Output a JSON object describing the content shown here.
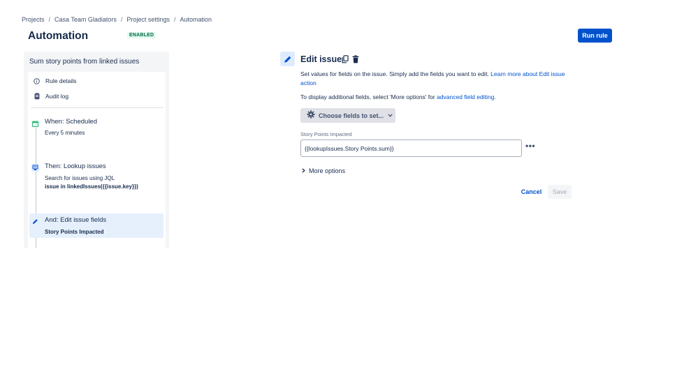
{
  "breadcrumb": {
    "items": [
      "Projects",
      "Casa Team Gladiators",
      "Project settings",
      "Automation"
    ],
    "separator": "/"
  },
  "page": {
    "title": "Automation",
    "status": "ENABLED",
    "run_rule_label": "Run rule"
  },
  "rule_panel": {
    "rule_name": "Sum story points from linked issues",
    "nav": [
      {
        "label": "Rule details",
        "icon": "info-icon"
      },
      {
        "label": "Audit log",
        "icon": "clipboard-icon"
      }
    ],
    "steps": [
      {
        "title": "When: Scheduled",
        "subtitle": "Every 5 minutes",
        "icon": "calendar-icon"
      },
      {
        "title": "Then: Lookup issues",
        "subtitle": "Search for issues using JQL",
        "detail": "issue in linkedIssues({{issue.key}})",
        "icon": "lookup-icon"
      },
      {
        "title": "And: Edit issue fields",
        "detail": "Story Points Impacted",
        "icon": "pencil-icon"
      }
    ]
  },
  "editor": {
    "title": "Edit issue",
    "description_line1": "Set values for fields on the issue. Simply add the fields you want to edit. ",
    "learn_more_link": "Learn more about Edit issue action",
    "description2": "To display additional fields, select 'More options' for ",
    "advanced_link": "advanced field editing",
    "description2_end": ".",
    "choose_fields_label": "Choose fields to set...",
    "field_label": "Story Points Impacted",
    "field_value": "{{lookupIssues.Story Points.sum}}",
    "more_options_label": "More options",
    "cancel_label": "Cancel",
    "save_label": "Save"
  },
  "colors": {
    "primary": "#0052cc",
    "enabled_bg": "#e3fcef",
    "enabled_text": "#006644",
    "selected_step_bg": "#e6f0fc"
  }
}
